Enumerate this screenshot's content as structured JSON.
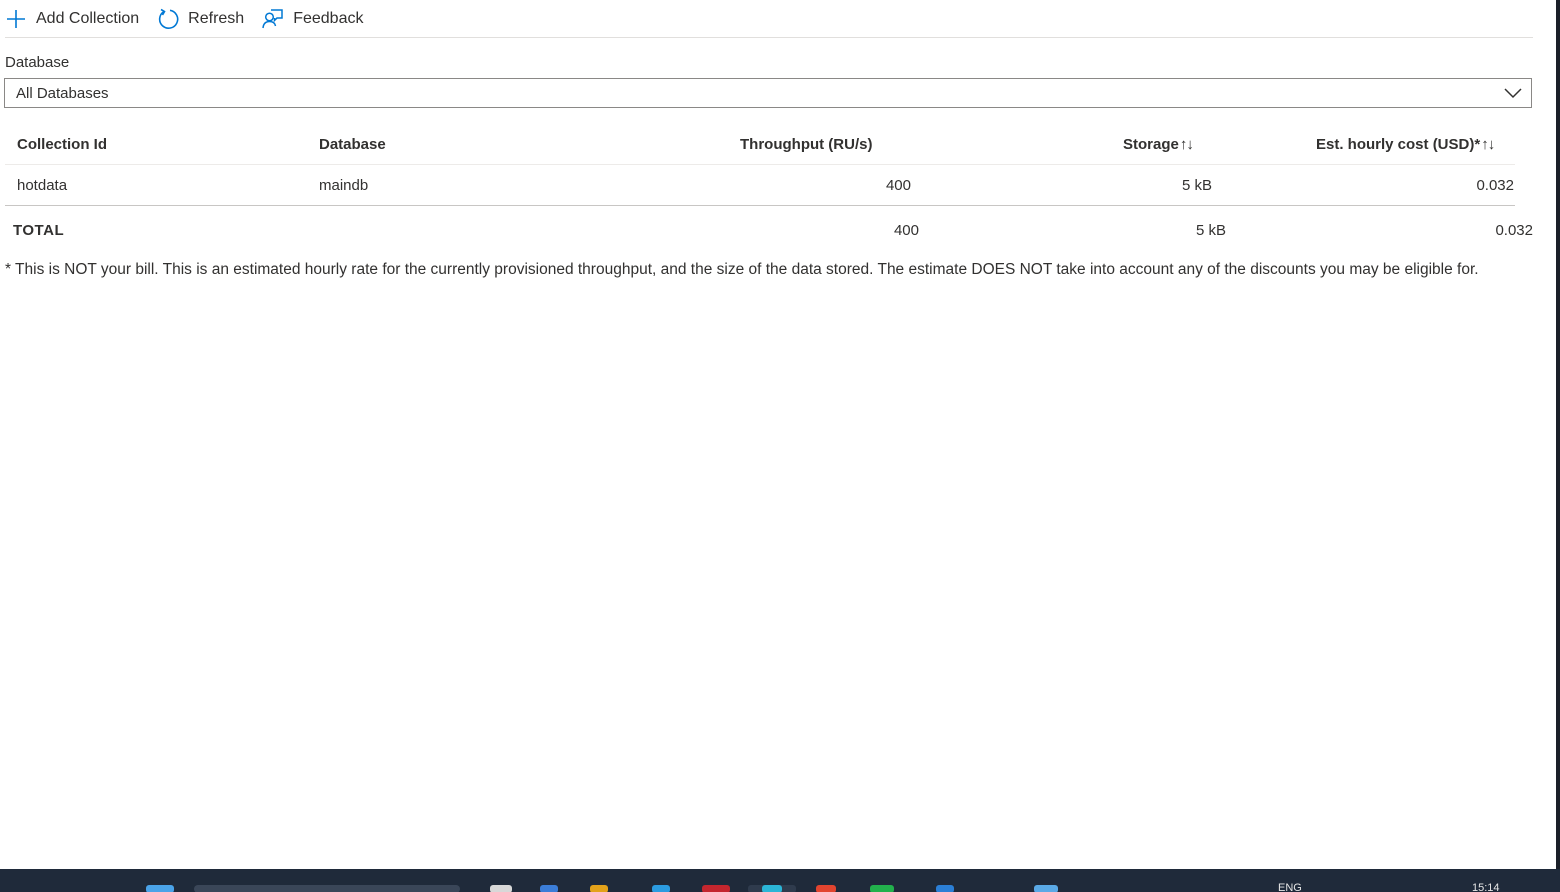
{
  "toolbar": {
    "add_collection": "Add Collection",
    "refresh": "Refresh",
    "feedback": "Feedback"
  },
  "filter": {
    "label": "Database",
    "selected": "All Databases"
  },
  "table": {
    "headers": {
      "collection_id": "Collection Id",
      "database": "Database",
      "throughput": "Throughput (RU/s)",
      "storage": "Storage",
      "cost": "Est. hourly cost (USD)*"
    },
    "sort_glyph": "↑↓",
    "rows": [
      {
        "collection_id": "hotdata",
        "database": "maindb",
        "throughput": "400",
        "storage": "5 kB",
        "cost": "0.032"
      }
    ]
  },
  "total": {
    "label": "TOTAL",
    "throughput": "400",
    "storage": "5 kB",
    "cost": "0.032"
  },
  "footnote": "* This is NOT your bill. This is an estimated hourly rate for the currently provisioned throughput, and the size of the data stored. The estimate DOES NOT take into account any of the discounts you may be eligible for.",
  "taskbar": {
    "language": "ENG",
    "time": "15:14"
  },
  "colors": {
    "accent": "#0078d4",
    "taskbar": "#1f2a3a"
  }
}
